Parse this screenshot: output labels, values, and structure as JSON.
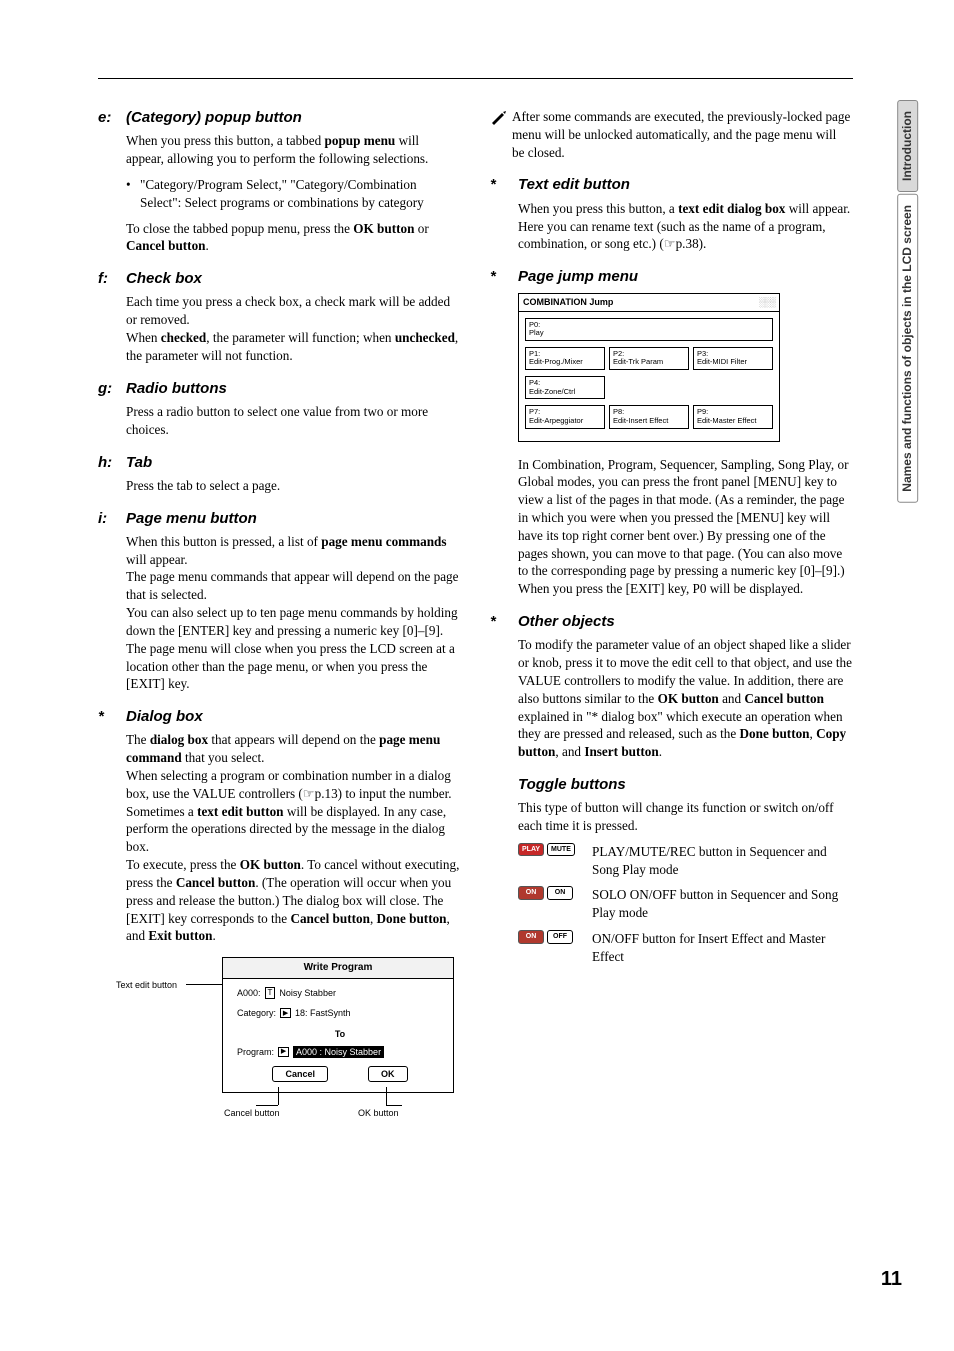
{
  "sidebar": {
    "box1": "Introduction",
    "box2": "Names and functions of objects in the LCD screen"
  },
  "page_number": "11",
  "left": {
    "e": {
      "letter": "e:",
      "title": "(Category) popup button",
      "p1a": "When you press this button, a tabbed ",
      "p1b": "popup menu",
      "p1c": " will appear, allowing you to perform the following selections.",
      "bullet": "\"Category/Program Select,\" \"Category/Combination Select\": Select programs or combinations by category",
      "p2a": "To close the tabbed popup menu, press the ",
      "p2b": "OK button",
      "p2c": " or ",
      "p2d": "Cancel button",
      "p2e": "."
    },
    "f": {
      "letter": "f:",
      "title": "Check box",
      "p1": "Each time you press a check box, a check mark will be added or removed.",
      "p2a": "When ",
      "p2b": "checked",
      "p2c": ", the parameter will function; when ",
      "p2d": "unchecked",
      "p2e": ", the parameter will not function."
    },
    "g": {
      "letter": "g:",
      "title": "Radio buttons",
      "p1": "Press a radio button to select one value from two or more choices."
    },
    "h": {
      "letter": "h:",
      "title": "Tab",
      "p1": "Press the tab to select a page."
    },
    "i": {
      "letter": "i:",
      "title": "Page menu button",
      "p1a": "When this button is pressed, a list of ",
      "p1b": "page menu commands",
      "p1c": " will appear.",
      "p2": "The page menu commands that appear will depend on the page that is selected.",
      "p3": "You can also select up to ten page menu commands by holding down the [ENTER] key and pressing a numeric key [0]–[9].",
      "p4": "The page menu will close when you press the LCD screen at a location other than the page menu, or when you press the [EXIT] key."
    },
    "dialog": {
      "letter": "*",
      "title": "Dialog box",
      "p1a": "The ",
      "p1b": "dialog box",
      "p1c": " that appears will depend on the ",
      "p1d": "page menu command",
      "p1e": " that you select.",
      "p2": "When selecting a program or combination number in a dialog box, use the VALUE controllers (☞p.13) to input the number.",
      "p3a": "Sometimes a ",
      "p3b": "text edit button",
      "p3c": " will be displayed. In any case, perform the operations directed by the message in the dialog box.",
      "p4a": "To execute, press the ",
      "p4b": "OK button",
      "p4c": ". To cancel without executing, press the ",
      "p4d": "Cancel button",
      "p4e": ". (The operation will occur when you press and release the button.) The dialog box will close. The [EXIT] key corresponds to the ",
      "p4f": "Cancel button",
      "p4g": ", ",
      "p4h": "Done button",
      "p4i": ", and ",
      "p4j": "Exit button",
      "p4k": "."
    },
    "wp": {
      "label_te": "Text edit button",
      "label_cancel": "Cancel button",
      "label_ok": "OK button",
      "title": "Write Program",
      "row1_code": "A000:",
      "row1_t": "T",
      "row1_name": "Noisy Stabber",
      "row2_label": "Category:",
      "row2_val": "18: FastSynth",
      "to": "To",
      "row3_label": "Program:",
      "row3_val": "A000 : Noisy Stabber",
      "cancel": "Cancel",
      "ok": "OK"
    }
  },
  "right": {
    "note": "After some commands are executed, the previously-locked page menu will be unlocked automatically, and the page menu will be closed.",
    "textedit": {
      "letter": "*",
      "title": "Text edit button",
      "p1a": "When you press this button, a ",
      "p1b": "text edit dialog box",
      "p1c": " will appear.",
      "p2": "Here you can rename text (such as the name of a program, combination, or song etc.) (☞p.38)."
    },
    "pjm": {
      "letter": "*",
      "title": "Page jump menu",
      "cj_header": "COMBINATION Jump",
      "cells": {
        "p0": "P0:\nPlay",
        "p1": "P1:\nEdit-Prog./Mixer",
        "p2": "P2:\nEdit-Trk Param",
        "p3": "P3:\nEdit-MIDI Filter",
        "p4": "P4:\nEdit-Zone/Ctrl",
        "p7": "P7:\nEdit-Arpeggiator",
        "p8": "P8:\nEdit-Insert Effect",
        "p9": "P9:\nEdit-Master Effect"
      },
      "p1": "In Combination, Program, Sequencer, Sampling, Song Play, or Global modes, you can press the front panel [MENU] key to view a list of the pages in that mode. (As a reminder, the page in which you were when you pressed the [MENU] key will have its top right corner bent over.) By pressing one of the pages shown, you can move to that page. (You can also move to the corresponding page by pressing a numeric key [0]–[9].)",
      "p2": "When you press the [EXIT] key, P0 will be displayed."
    },
    "other": {
      "letter": "*",
      "title": "Other objects",
      "p1a": "To modify the parameter value of an object shaped like a slider or knob, press it to move the edit cell to that object, and use the VALUE controllers to modify the value. In addition, there are also buttons similar to the ",
      "p1b": "OK button",
      "p1c": " and ",
      "p1d": "Cancel button",
      "p1e": " explained in \"* dialog box\" which execute an operation when they are pressed and released, such as the ",
      "p1f": "Done button",
      "p1g": ", ",
      "p1h": "Copy button",
      "p1i": ", and ",
      "p1j": "Insert button",
      "p1k": "."
    },
    "toggle": {
      "title": "Toggle buttons",
      "p1": "This type of button will change its function or switch on/off each time it is pressed.",
      "r1_btn1": "PLAY",
      "r1_btn2": "MUTE",
      "r1_text": "PLAY/MUTE/REC button in Sequencer and Song Play mode",
      "r2_btn1": "ON",
      "r2_btn2": "ON",
      "r2_text": "SOLO ON/OFF button in Sequencer and Song Play mode",
      "r3_btn1": "ON",
      "r3_btn2": "OFF",
      "r3_text": "ON/OFF button for Insert Effect and Master Effect"
    }
  }
}
